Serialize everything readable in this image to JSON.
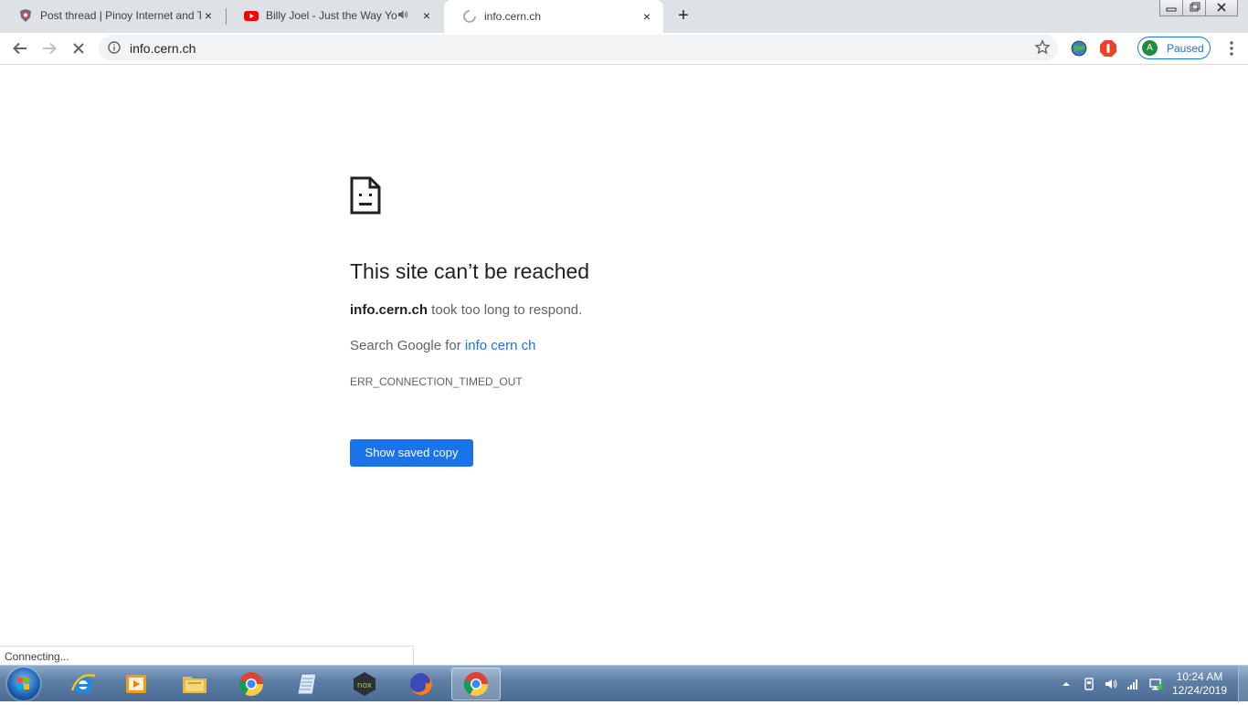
{
  "tabs": [
    {
      "title": "Post thread | Pinoy Internet and T",
      "favicon": "pinoy-forum-icon",
      "close": "×"
    },
    {
      "title": "Billy Joel - Just the Way You",
      "favicon": "youtube-icon",
      "audio": "speaker-icon",
      "close": "×"
    },
    {
      "title": "info.cern.ch",
      "favicon": "loading-spinner-icon",
      "close": "×",
      "active": true
    }
  ],
  "new_tab_label": "+",
  "toolbar": {
    "url": "info.cern.ch",
    "profile_initial": "A",
    "profile_status": "Paused"
  },
  "error_page": {
    "title": "This site can’t be reached",
    "host": "info.cern.ch",
    "message_suffix": " took too long to respond.",
    "search_prefix": "Search Google for ",
    "search_link": "info cern ch",
    "error_code": "ERR_CONNECTION_TIMED_OUT",
    "button_label": "Show saved copy"
  },
  "status_bar": "Connecting...",
  "taskbar": {
    "apps": [
      "internet-explorer-icon",
      "media-player-icon",
      "file-explorer-icon",
      "chrome-icon",
      "notepad-icon",
      "nox-icon",
      "firefox-icon",
      "chrome-icon"
    ],
    "time": "10:24 AM",
    "date": "12/24/2019"
  },
  "colors": {
    "accent": "#1a73e8",
    "tabstrip": "#dee1e6"
  }
}
